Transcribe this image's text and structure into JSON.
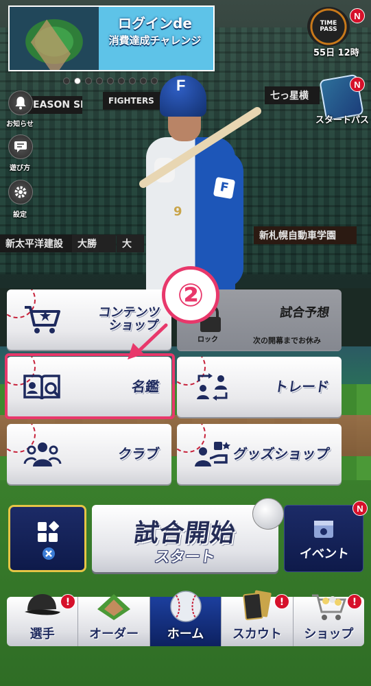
{
  "banner": {
    "title_line1": "ログインde",
    "title_line2": "消費達成チャレンジ",
    "page_count": 9,
    "active_page": 1
  },
  "time_pass": {
    "icon_text": "TIME PASS",
    "remaining": "55日 12時",
    "badge": "N"
  },
  "start_pass": {
    "label": "スタートパス",
    "badge": "N"
  },
  "side_menu": [
    {
      "label": "お知らせ",
      "icon": "bell-icon"
    },
    {
      "label": "遊び方",
      "icon": "chat-icon"
    },
    {
      "label": "設定",
      "icon": "gear-icon"
    }
  ],
  "background_boards": {
    "board1": "EASON SEAT",
    "board2": "FIGHTERS",
    "board3": "七っ星横",
    "board4": "新太平洋建設",
    "board5": "大勝",
    "board6": "大",
    "board7": "新札幌自動車学園"
  },
  "menu": {
    "content_shop": {
      "label_line1": "コンテンツ",
      "label_line2": "ショップ"
    },
    "match_prediction": {
      "label": "試合予想",
      "lock_label": "ロック",
      "sub": "次の開幕までお休み"
    },
    "encyclopedia": {
      "label": "名鑑"
    },
    "trade": {
      "label": "トレード"
    },
    "club": {
      "label": "クラブ"
    },
    "goods_shop": {
      "label": "グッズショップ"
    }
  },
  "tutorial": {
    "step": "②"
  },
  "actions": {
    "start_main": "試合開始",
    "start_sub": "スタート",
    "event_label": "イベント",
    "event_badge": "N"
  },
  "nav": [
    {
      "label": "選手",
      "badge": "!",
      "active": false
    },
    {
      "label": "オーダー",
      "badge": "",
      "active": false
    },
    {
      "label": "ホーム",
      "badge": "",
      "active": true
    },
    {
      "label": "スカウト",
      "badge": "!",
      "active": false
    },
    {
      "label": "ショップ",
      "badge": "!",
      "active": false
    }
  ],
  "colors": {
    "highlight": "#e8386b",
    "navy": "#1e2a5e",
    "badge_red": "#d6112b",
    "gold_border": "#e6c545"
  }
}
